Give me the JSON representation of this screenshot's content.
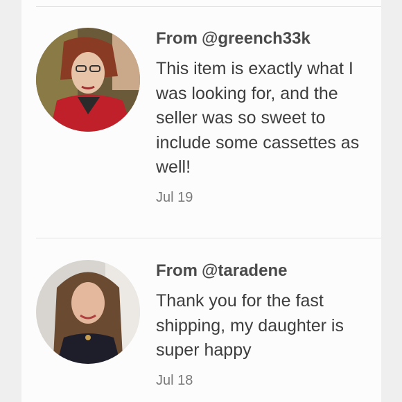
{
  "reviews": [
    {
      "from_prefix": "From",
      "handle": "@greench33k",
      "text": "This item is exactly what I was looking for, and the seller was so sweet to include some cassettes as well!",
      "date": "Jul 19"
    },
    {
      "from_prefix": "From",
      "handle": "@taradene",
      "text": "Thank you for the fast shipping, my daughter is super happy",
      "date": "Jul 18"
    }
  ],
  "colors": {
    "page_bg": "#efefef",
    "panel_bg": "#fcfcfc",
    "author_text": "#4a4a4a",
    "body_text": "#3d3d3d",
    "date_text": "#7a7a7a"
  }
}
